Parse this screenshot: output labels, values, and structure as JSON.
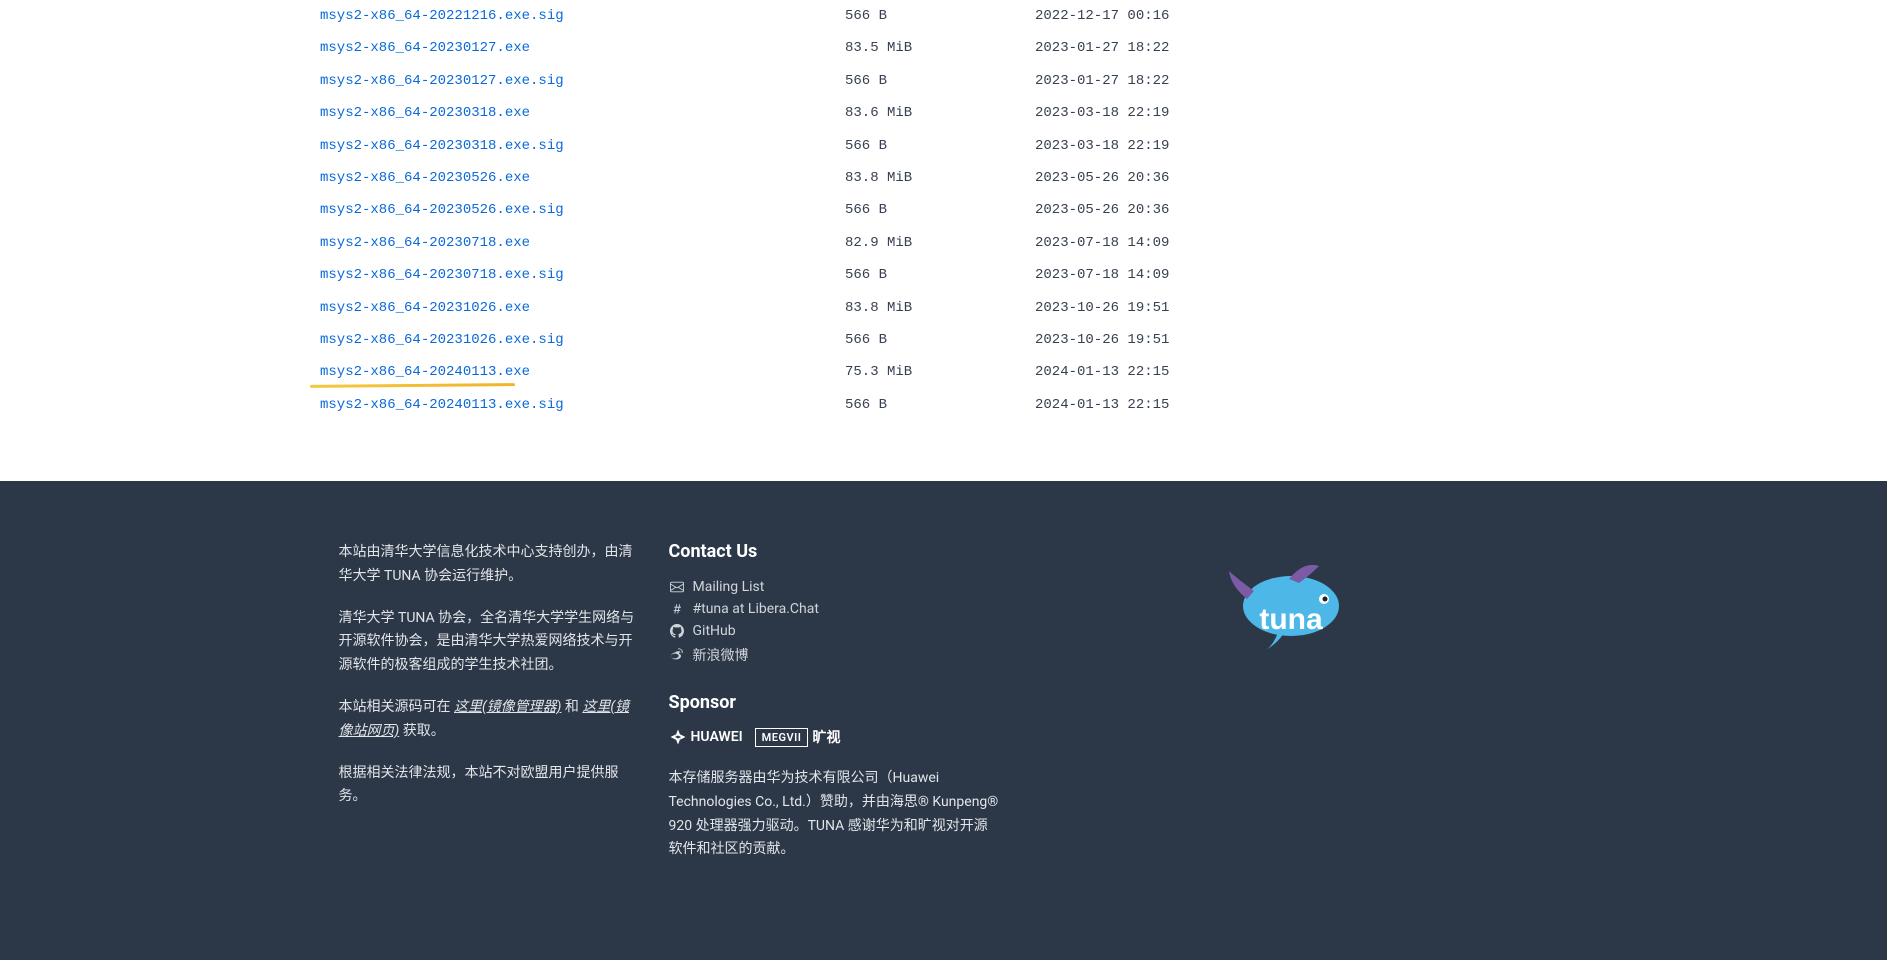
{
  "files": [
    {
      "name": "msys2-x86_64-20221216.exe.sig",
      "size": "566 B",
      "date": "2022-12-17 00:16",
      "highlighted": false
    },
    {
      "name": "msys2-x86_64-20230127.exe",
      "size": "83.5 MiB",
      "date": "2023-01-27 18:22",
      "highlighted": false
    },
    {
      "name": "msys2-x86_64-20230127.exe.sig",
      "size": "566 B",
      "date": "2023-01-27 18:22",
      "highlighted": false
    },
    {
      "name": "msys2-x86_64-20230318.exe",
      "size": "83.6 MiB",
      "date": "2023-03-18 22:19",
      "highlighted": false
    },
    {
      "name": "msys2-x86_64-20230318.exe.sig",
      "size": "566 B",
      "date": "2023-03-18 22:19",
      "highlighted": false
    },
    {
      "name": "msys2-x86_64-20230526.exe",
      "size": "83.8 MiB",
      "date": "2023-05-26 20:36",
      "highlighted": false
    },
    {
      "name": "msys2-x86_64-20230526.exe.sig",
      "size": "566 B",
      "date": "2023-05-26 20:36",
      "highlighted": false
    },
    {
      "name": "msys2-x86_64-20230718.exe",
      "size": "82.9 MiB",
      "date": "2023-07-18 14:09",
      "highlighted": false
    },
    {
      "name": "msys2-x86_64-20230718.exe.sig",
      "size": "566 B",
      "date": "2023-07-18 14:09",
      "highlighted": false
    },
    {
      "name": "msys2-x86_64-20231026.exe",
      "size": "83.8 MiB",
      "date": "2023-10-26 19:51",
      "highlighted": false
    },
    {
      "name": "msys2-x86_64-20231026.exe.sig",
      "size": "566 B",
      "date": "2023-10-26 19:51",
      "highlighted": false
    },
    {
      "name": "msys2-x86_64-20240113.exe",
      "size": "75.3 MiB",
      "date": "2024-01-13 22:15",
      "highlighted": true
    },
    {
      "name": "msys2-x86_64-20240113.exe.sig",
      "size": "566 B",
      "date": "2024-01-13 22:15",
      "highlighted": false
    }
  ],
  "footer": {
    "about": {
      "p1": "本站由清华大学信息化技术中心支持创办，由清华大学 TUNA 协会运行维护。",
      "p2": "清华大学 TUNA 协会，全名清华大学学生网络与开源软件协会，是由清华大学热爱网络技术与开源软件的极客组成的学生技术社团。",
      "p3_prefix": "本站相关源码可在 ",
      "p3_link1": "这里(镜像管理器)",
      "p3_middle": " 和 ",
      "p3_link2": "这里(镜像站网页)",
      "p3_suffix": " 获取。",
      "p4": "根据相关法律法规，本站不对欧盟用户提供服务。"
    },
    "contact": {
      "heading": "Contact Us",
      "items": [
        {
          "icon": "mail",
          "label": "Mailing List"
        },
        {
          "icon": "hash",
          "label": "#tuna at Libera.Chat"
        },
        {
          "icon": "github",
          "label": "GitHub"
        },
        {
          "icon": "weibo",
          "label": "新浪微博"
        }
      ]
    },
    "sponsor": {
      "heading": "Sponsor",
      "huawei": "HUAWEI",
      "megvii": "MEGVII",
      "megvii_cn": "旷视",
      "text": "本存储服务器由华为技术有限公司（Huawei Technologies Co., Ltd.）赞助，并由海思® Kunpeng® 920 处理器强力驱动。TUNA 感谢华为和旷视对开源软件和社区的贡献。"
    }
  }
}
